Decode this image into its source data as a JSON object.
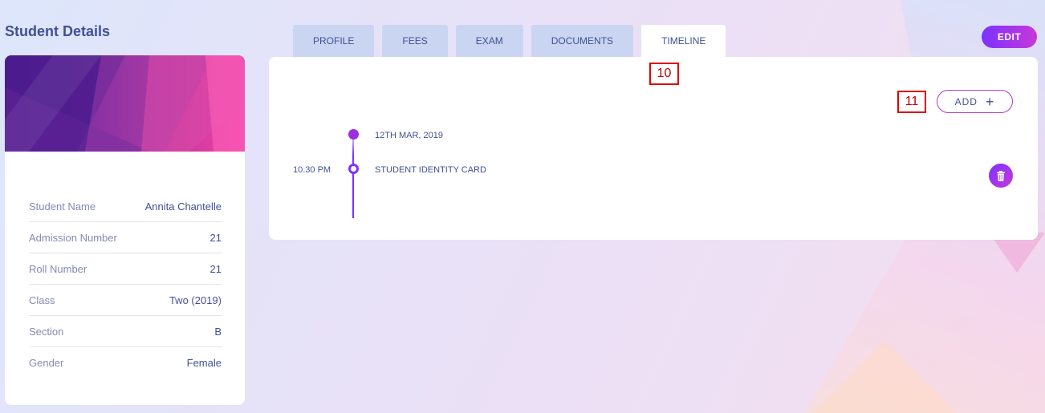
{
  "page": {
    "title": "Student Details"
  },
  "tabs": [
    {
      "label": "PROFILE",
      "active": false
    },
    {
      "label": "FEES",
      "active": false
    },
    {
      "label": "EXAM",
      "active": false
    },
    {
      "label": "DOCUMENTS",
      "active": false
    },
    {
      "label": "TIMELINE",
      "active": true
    }
  ],
  "header": {
    "edit_label": "EDIT"
  },
  "markers": {
    "tab_marker": "10",
    "add_marker": "11"
  },
  "timeline": {
    "add_label": "ADD",
    "add_icon": "plus-icon",
    "entries": [
      {
        "date": "12TH MAR, 2019",
        "time": "10.30 PM",
        "title": "STUDENT IDENTITY CARD",
        "delete_icon": "trash-icon"
      }
    ]
  },
  "student": {
    "details": [
      {
        "label": "Student Name",
        "value": "Annita Chantelle"
      },
      {
        "label": "Admission Number",
        "value": "21"
      },
      {
        "label": "Roll Number",
        "value": "21"
      },
      {
        "label": "Class",
        "value": "Two (2019)"
      },
      {
        "label": "Section",
        "value": "B"
      },
      {
        "label": "Gender",
        "value": "Female"
      }
    ]
  },
  "colors": {
    "accent": "#7c32ff",
    "accent_pink": "#c738d8",
    "text_primary": "#415094",
    "text_muted": "#828bb2",
    "tab_bg": "#cad5f1"
  }
}
